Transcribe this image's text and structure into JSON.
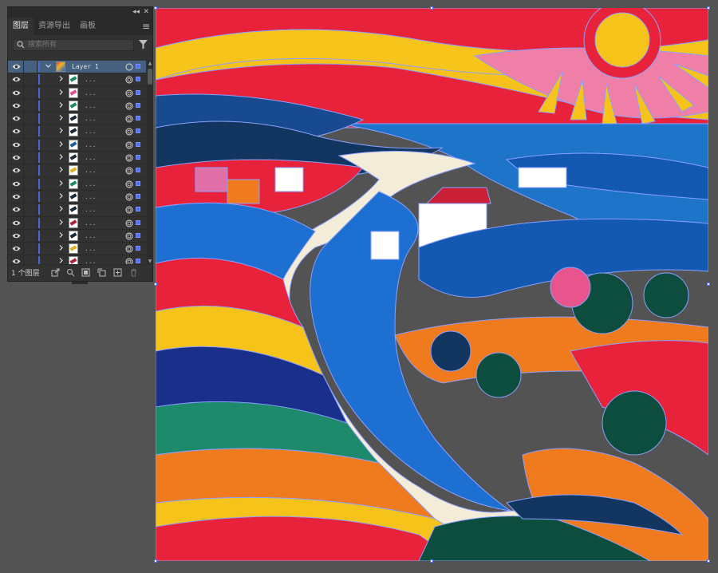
{
  "panel": {
    "tabs": [
      {
        "label": "图层",
        "active": true
      },
      {
        "label": "资源导出",
        "active": false
      },
      {
        "label": "画板",
        "active": false
      }
    ],
    "search": {
      "placeholder": "搜索所有"
    },
    "main_layer": {
      "name": "Layer 1"
    },
    "sublayer_name": "...",
    "sublayers": [
      {
        "thumb_color": "#1d8a6b"
      },
      {
        "thumb_color": "#e94e93"
      },
      {
        "thumb_color": "#1d8a6b"
      },
      {
        "thumb_color": "#1a2a3a"
      },
      {
        "thumb_color": "#1a2a3a"
      },
      {
        "thumb_color": "#1d5f9a"
      },
      {
        "thumb_color": "#1a2a3a"
      },
      {
        "thumb_color": "#e0b020"
      },
      {
        "thumb_color": "#1d8a6b"
      },
      {
        "thumb_color": "#1a2a3a"
      },
      {
        "thumb_color": "#1a2a3a"
      },
      {
        "thumb_color": "#b02040"
      },
      {
        "thumb_color": "#1a2a3a"
      },
      {
        "thumb_color": "#e0b020"
      },
      {
        "thumb_color": "#b02040"
      }
    ],
    "footer": {
      "layer_count": "1 个图层"
    },
    "accent": "#4b66d6"
  },
  "artwork": {
    "subject": "colorful landscape illustration with river, village and sun"
  }
}
